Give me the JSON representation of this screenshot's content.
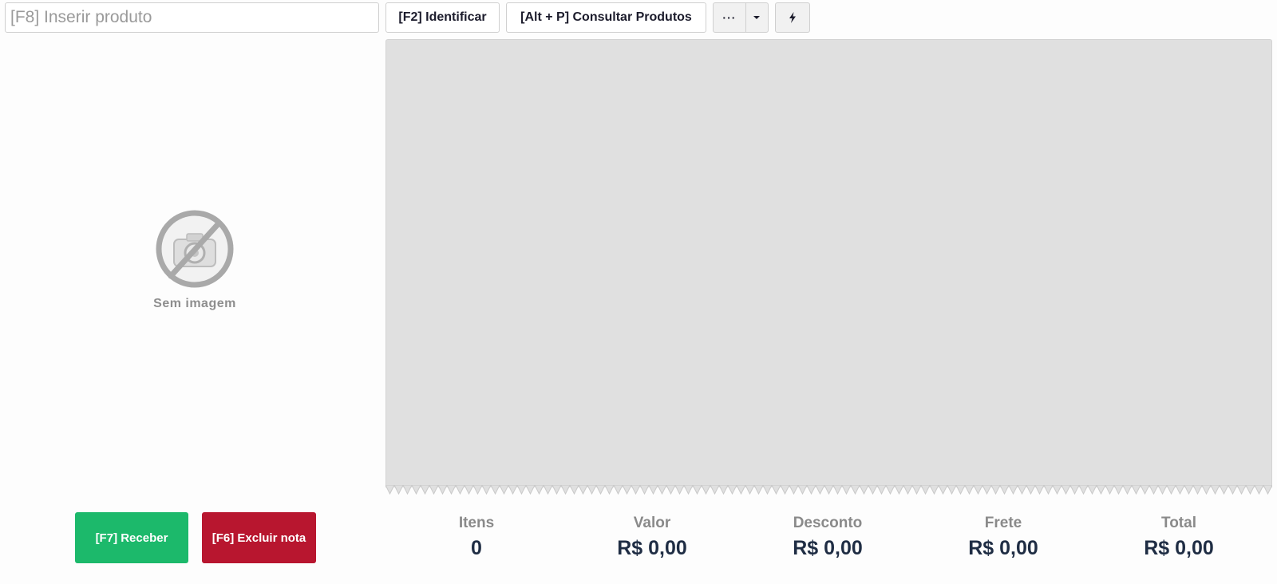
{
  "toolbar": {
    "product_placeholder": "[F8] Inserir produto",
    "identify_label": "[F2] Identificar",
    "consult_label": "[Alt + P] Consultar Produtos",
    "more_label": "···",
    "more_icon": "chevron-down-icon",
    "flash_icon": "lightning-icon"
  },
  "product_image": {
    "icon": "no-camera-icon",
    "caption": "Sem imagem"
  },
  "actions": {
    "receive_label": "[F7] Receber",
    "delete_label": "[F6] Excluir nota",
    "receive_color": "#1cb96b",
    "delete_color": "#b8162f"
  },
  "totals": [
    {
      "label": "Itens",
      "value": "0"
    },
    {
      "label": "Valor",
      "value": "R$ 0,00"
    },
    {
      "label": "Desconto",
      "value": "R$ 0,00"
    },
    {
      "label": "Frete",
      "value": "R$ 0,00"
    },
    {
      "label": "Total",
      "value": "R$ 0,00"
    }
  ]
}
